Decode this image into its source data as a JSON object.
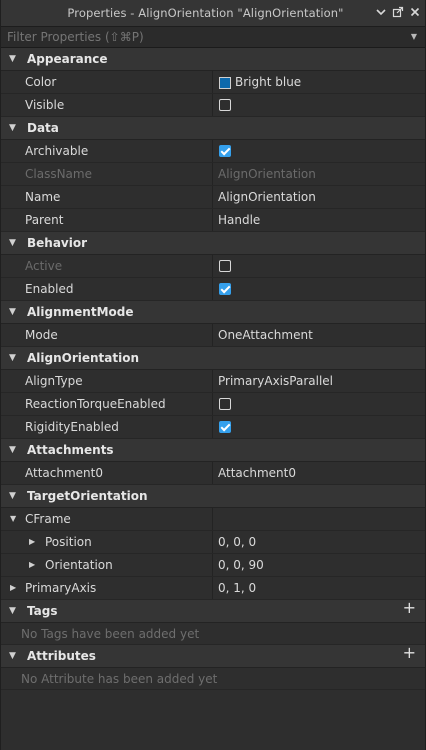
{
  "window": {
    "title": "Properties - AlignOrientation \"AlignOrientation\"",
    "icons": [
      "chevron-down-icon",
      "popout-icon",
      "close-icon"
    ]
  },
  "filter": {
    "placeholder": "Filter Properties (⇧⌘P)"
  },
  "colors": {
    "accent": "#35a0ec",
    "bright_blue": "#0d69ac"
  },
  "sections": {
    "appearance": {
      "label": "Appearance",
      "color_name": "Color",
      "color_value": "Bright blue",
      "visible_name": "Visible",
      "visible_checked": false
    },
    "data": {
      "label": "Data",
      "archivable_name": "Archivable",
      "archivable_checked": true,
      "classname_name": "ClassName",
      "classname_value": "AlignOrientation",
      "name_name": "Name",
      "name_value": "AlignOrientation",
      "parent_name": "Parent",
      "parent_value": "Handle"
    },
    "behavior": {
      "label": "Behavior",
      "active_name": "Active",
      "active_checked": false,
      "enabled_name": "Enabled",
      "enabled_checked": true
    },
    "alignment_mode": {
      "label": "AlignmentMode",
      "mode_name": "Mode",
      "mode_value": "OneAttachment"
    },
    "align_orientation": {
      "label": "AlignOrientation",
      "aligntype_name": "AlignType",
      "aligntype_value": "PrimaryAxisParallel",
      "reaction_name": "ReactionTorqueEnabled",
      "reaction_checked": false,
      "rigidity_name": "RigidityEnabled",
      "rigidity_checked": true
    },
    "attachments": {
      "label": "Attachments",
      "att0_name": "Attachment0",
      "att0_value": "Attachment0"
    },
    "target_orientation": {
      "label": "TargetOrientation",
      "cframe_name": "CFrame",
      "position_name": "Position",
      "position_value": "0, 0, 0",
      "orientation_name": "Orientation",
      "orientation_value": "0, 0, 90",
      "primaryaxis_name": "PrimaryAxis",
      "primaryaxis_value": "0, 1, 0"
    },
    "tags": {
      "label": "Tags",
      "empty": "No Tags have been added yet"
    },
    "attributes": {
      "label": "Attributes",
      "empty": "No Attribute has been added yet"
    }
  }
}
